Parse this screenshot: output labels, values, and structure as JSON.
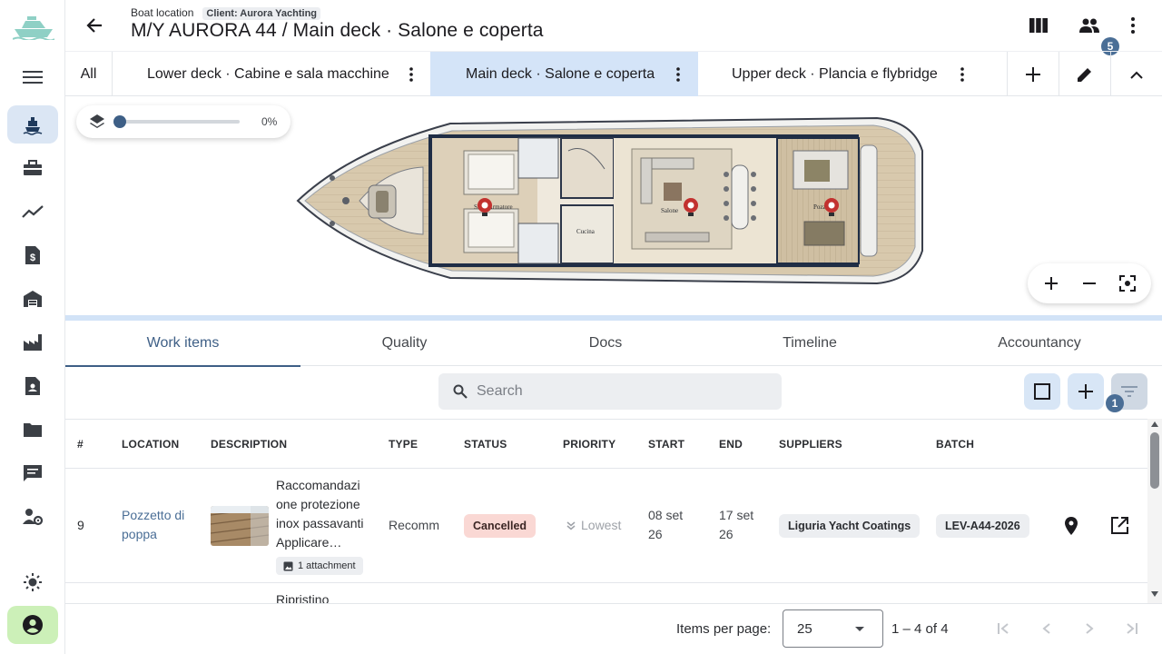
{
  "header": {
    "kicker": "Boat location",
    "client": "Client: Aurora Yachting",
    "title": "M/Y AURORA 44 / Main deck · Salone e coperta",
    "team_badge": "5"
  },
  "decks": {
    "all": "All",
    "items": [
      {
        "label": "Lower deck · Cabine e sala macchine",
        "selected": false
      },
      {
        "label": "Main deck · Salone e coperta",
        "selected": true
      },
      {
        "label": "Upper deck · Plancia e flybridge",
        "selected": false
      }
    ]
  },
  "layer_slider": {
    "value_label": "0%",
    "value": 0
  },
  "plan": {
    "labels": {
      "suite": "Suite Armatore",
      "salone": "Salone",
      "cucina": "Cucina",
      "pozzetto": "Pozzetto"
    }
  },
  "section_tabs": [
    "Work items",
    "Quality",
    "Docs",
    "Timeline",
    "Accountancy"
  ],
  "toolbar": {
    "search_placeholder": "Search",
    "filter_badge": "1"
  },
  "table": {
    "columns": [
      "#",
      "LOCATION",
      "DESCRIPTION",
      "TYPE",
      "STATUS",
      "PRIORITY",
      "START",
      "END",
      "SUPPLIERS",
      "BATCH"
    ],
    "rows": [
      {
        "num": "9",
        "location": "Pozzetto di poppa",
        "description": "Raccomandazi one protezione inox passavanti Applicare…",
        "attachment": "1 attachment",
        "type": "Recomm",
        "status": "Cancelled",
        "priority": "Lowest",
        "start": "08 set 26",
        "end": "17 set 26",
        "supplier": "Liguria Yacht Coatings",
        "batch": "LEV-A44-2026"
      },
      {
        "description": "Ripristino"
      }
    ]
  },
  "pager": {
    "items_per_page_label": "Items per page:",
    "page_size": "25",
    "range": "1 – 4 of 4"
  },
  "colors": {
    "accent": "#3e5f86",
    "selected_tab": "#d4e4f8",
    "cancelled_bg": "#fad8d4",
    "account": "#ccf0b8",
    "pin": "#c2312f"
  }
}
